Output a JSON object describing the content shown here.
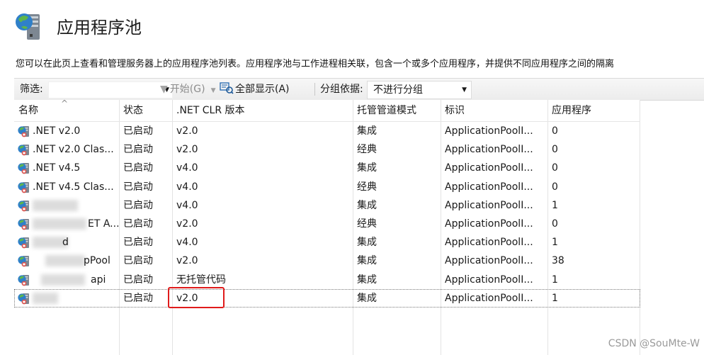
{
  "header": {
    "title": "应用程序池",
    "description": "您可以在此页上查看和管理服务器上的应用程序池列表。应用程序池与工作进程相关联，包含一个或多个应用程序，并提供不同应用程序之间的隔离"
  },
  "toolbar": {
    "filter_label": "筛选:",
    "filter_value": "",
    "start_label": "开始(G)",
    "show_all_label": "全部显示(A)",
    "group_by_label": "分组依据:",
    "group_by_value": "不进行分组"
  },
  "table": {
    "columns": [
      "名称",
      "状态",
      ".NET CLR 版本",
      "托管管道模式",
      "标识",
      "应用程序"
    ],
    "rows": [
      {
        "name": ".NET v2.0",
        "status": "已启动",
        "clr": "v2.0",
        "pipeline": "集成",
        "identity": "ApplicationPoolI...",
        "apps": "0"
      },
      {
        "name": ".NET v2.0 Clas...",
        "status": "已启动",
        "clr": "v2.0",
        "pipeline": "经典",
        "identity": "ApplicationPoolI...",
        "apps": "0"
      },
      {
        "name": ".NET v4.5",
        "status": "已启动",
        "clr": "v4.0",
        "pipeline": "集成",
        "identity": "ApplicationPoolI...",
        "apps": "0"
      },
      {
        "name": ".NET v4.5 Clas...",
        "status": "已启动",
        "clr": "v4.0",
        "pipeline": "经典",
        "identity": "ApplicationPoolI...",
        "apps": "0"
      },
      {
        "name": "",
        "status": "已启动",
        "clr": "v4.0",
        "pipeline": "集成",
        "identity": "ApplicationPoolI...",
        "apps": "1"
      },
      {
        "name": "ET A...",
        "status": "已启动",
        "clr": "v2.0",
        "pipeline": "经典",
        "identity": "ApplicationPoolI...",
        "apps": "0"
      },
      {
        "name": "d",
        "status": "已启动",
        "clr": "v4.0",
        "pipeline": "集成",
        "identity": "ApplicationPoolI...",
        "apps": "1"
      },
      {
        "name": "pPool",
        "status": "已启动",
        "clr": "v2.0",
        "pipeline": "集成",
        "identity": "ApplicationPoolI...",
        "apps": "38"
      },
      {
        "name": "api",
        "status": "已启动",
        "clr": "无托管代码",
        "pipeline": "集成",
        "identity": "ApplicationPoolI...",
        "apps": "1"
      },
      {
        "name": "",
        "status": "已启动",
        "clr": "v2.0",
        "pipeline": "集成",
        "identity": "ApplicationPoolI...",
        "apps": "1"
      }
    ]
  },
  "watermark": "CSDN @SouMte-W",
  "colors": {
    "highlight": "#e01b1b"
  }
}
